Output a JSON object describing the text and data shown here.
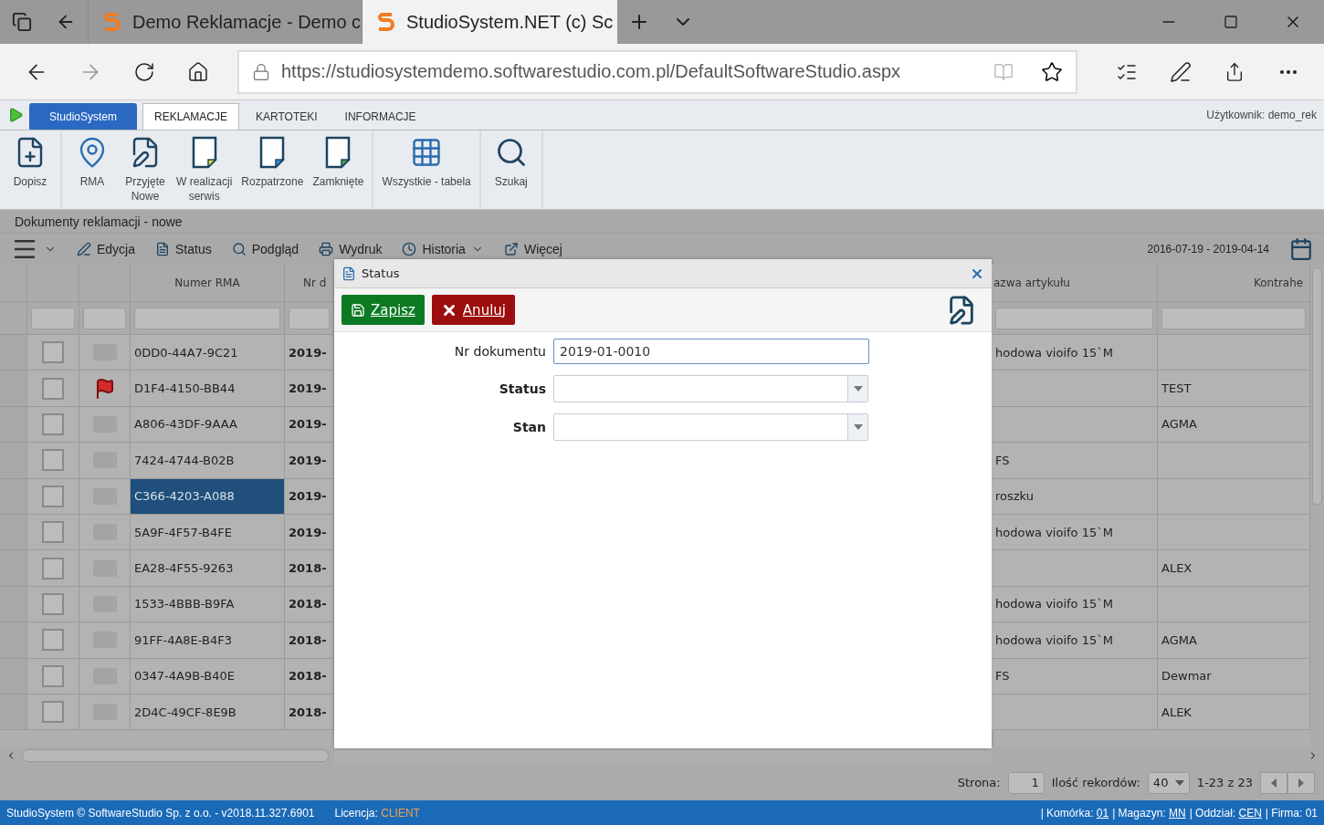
{
  "browser": {
    "tabs": [
      {
        "title": "Demo Reklamacje - Demo c",
        "selected": false
      },
      {
        "title": "StudioSystem.NET (c) Sc",
        "selected": true
      }
    ],
    "url": "https://studiosystemdemo.softwarestudio.com.pl/DefaultSoftwareStudio.aspx"
  },
  "app_menu": "StudioSystem",
  "app_tabs": [
    {
      "label": "REKLAMACJE",
      "selected": true
    },
    {
      "label": "KARTOTEKI",
      "selected": false
    },
    {
      "label": "INFORMACJE",
      "selected": false
    }
  ],
  "user": "Użytkownik: demo_rek",
  "ribbon": [
    [
      "Dopisz"
    ],
    [
      "RMA",
      "Przyjęte\nNowe",
      "W realizacji\nserwis",
      "Rozpatrzone",
      "Zamknięte"
    ],
    [
      "Wszystkie - tabela"
    ],
    [
      "Szukaj"
    ]
  ],
  "section_title": "Dokumenty reklamacji - nowe",
  "toolbar": [
    {
      "label": "Edycja",
      "dropdown": false
    },
    {
      "label": "Status",
      "dropdown": false
    },
    {
      "label": "Podgląd",
      "dropdown": false
    },
    {
      "label": "Wydruk",
      "dropdown": false
    },
    {
      "label": "Historia",
      "dropdown": true
    },
    {
      "label": "Więcej",
      "dropdown": false
    }
  ],
  "date_range": "2016-07-19 - 2019-04-14",
  "grid": {
    "columns_left": [
      "Numer RMA",
      "Nr d"
    ],
    "columns_right": [
      "azwa artykułu",
      "Kontrahe"
    ],
    "rows": [
      {
        "checked": false,
        "flagged": false,
        "selected": false,
        "rma": "0DD0-44A7-9C21",
        "doc": "2019-",
        "article": "hodowa vioifo 15`M"
      },
      {
        "checked": false,
        "flagged": true,
        "selected": false,
        "rma": "D1F4-4150-BB44",
        "doc": "2019-",
        "contractor": "TEST"
      },
      {
        "checked": false,
        "flagged": false,
        "selected": false,
        "rma": "A806-43DF-9AAA",
        "doc": "2019-",
        "contractor": "AGMA"
      },
      {
        "checked": false,
        "flagged": false,
        "selected": false,
        "rma": "7424-4744-B02B",
        "doc": "2019-",
        "article": "FS"
      },
      {
        "checked": false,
        "flagged": false,
        "selected": true,
        "rma": "C366-4203-A088",
        "doc": "2019-",
        "article": "roszku"
      },
      {
        "checked": false,
        "flagged": false,
        "selected": false,
        "rma": "5A9F-4F57-B4FE",
        "doc": "2019-",
        "article": "hodowa vioifo 15`M"
      },
      {
        "checked": false,
        "flagged": false,
        "selected": false,
        "rma": "EA28-4F55-9263",
        "doc": "2018-",
        "contractor": "ALEX"
      },
      {
        "checked": false,
        "flagged": false,
        "selected": false,
        "rma": "1533-4BBB-B9FA",
        "doc": "2018-",
        "article": "hodowa vioifo 15`M"
      },
      {
        "checked": false,
        "flagged": false,
        "selected": false,
        "rma": "91FF-4A8E-B4F3",
        "doc": "2018-",
        "article": "hodowa vioifo 15`M",
        "contractor": "AGMA"
      },
      {
        "checked": false,
        "flagged": false,
        "selected": false,
        "rma": "0347-4A9B-B40E",
        "doc": "2018-",
        "article": "FS",
        "contractor": "Dewmar"
      },
      {
        "checked": false,
        "flagged": false,
        "selected": false,
        "rma": "2D4C-49CF-8E9B",
        "doc": "2018-",
        "contractor": "ALEK"
      }
    ]
  },
  "dialog": {
    "title": "Status",
    "buttons": [
      {
        "label": "Zapisz",
        "kind": "save"
      },
      {
        "label": "Anuluj",
        "kind": "cancel"
      }
    ],
    "fields": [
      {
        "label": "Nr dokumentu",
        "kind": "text",
        "value": "2019-01-0010",
        "required": false
      },
      {
        "label": "Status",
        "kind": "select",
        "required": true
      },
      {
        "label": "Stan",
        "kind": "select",
        "required": true
      }
    ]
  },
  "pager": {
    "page_label": "Strona:",
    "page": "1",
    "count_label": "Ilość rekordów:",
    "count": "40",
    "range": "1-23 z 23"
  },
  "status_bar": {
    "copyright": "StudioSystem © SoftwareStudio Sp. z o.o. - v2018.11.327.6901",
    "license_label": "Licencja:",
    "license": "CLIENT",
    "items": [
      {
        "label": "| Komórka:",
        "value": "01",
        "linked": true
      },
      {
        "label": "| Magazyn:",
        "value": "MN",
        "linked": true
      },
      {
        "label": "| Oddział:",
        "value": "CEN",
        "linked": true
      },
      {
        "label": "| Firma:",
        "value": "01",
        "linked": false
      }
    ]
  }
}
